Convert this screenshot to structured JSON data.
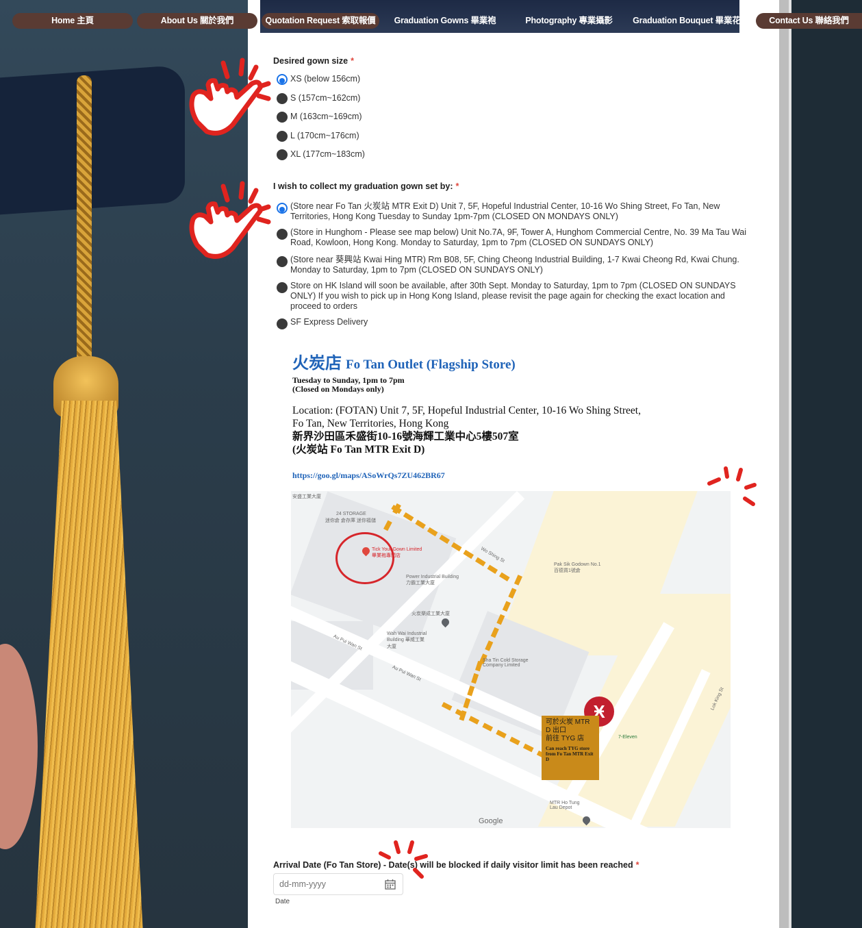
{
  "nav": {
    "items": [
      {
        "label": "Home 主頁"
      },
      {
        "label": "About Us 關於我們"
      },
      {
        "label": "Quotation Request 索取報價"
      },
      {
        "label": "Graduation Gowns 畢業袍"
      },
      {
        "label": "Photography 專業攝影"
      },
      {
        "label": "Graduation Bouquet 畢業花束"
      },
      {
        "label": "Contact Us 聯絡我們"
      }
    ]
  },
  "gown_size": {
    "label": "Desired gown size",
    "required_mark": "*",
    "options": [
      {
        "label": "XS (below 156cm)",
        "selected": true
      },
      {
        "label": "S (157cm~162cm)",
        "selected": false
      },
      {
        "label": "M (163cm~169cm)",
        "selected": false
      },
      {
        "label": "L (170cm~176cm)",
        "selected": false
      },
      {
        "label": "XL (177cm~183cm)",
        "selected": false
      }
    ]
  },
  "collection": {
    "label": "I wish to collect my graduation gown set by:",
    "required_mark": "*",
    "options": [
      {
        "label": "(Store near Fo Tan 火炭站 MTR Exit D) Unit 7, 5F, Hopeful Industrial Center, 10-16 Wo Shing Street, Fo Tan, New Territories, Hong Kong Tuesday to Sunday 1pm-7pm (CLOSED ON MONDAYS ONLY)",
        "selected": true
      },
      {
        "label": "(Store in Hunghom - Please see map below) Unit No.7A, 9F, Tower A, Hunghom Commercial Centre, No. 39 Ma Tau Wai Road, Kowloon, Hong Kong. Monday to Saturday, 1pm to 7pm (CLOSED ON SUNDAYS ONLY)",
        "selected": false
      },
      {
        "label": "(Store near 葵興站 Kwai Hing MTR) Rm B08, 5F, Ching Cheong Industrial Building, 1-7 Kwai Cheong Rd, Kwai Chung. Monday to Saturday, 1pm to 7pm (CLOSED ON SUNDAYS ONLY)",
        "selected": false
      },
      {
        "label": "Store on HK Island will soon be available, after 30th Sept. Monday to Saturday, 1pm to 7pm (CLOSED ON SUNDAYS ONLY)  If you wish to pick up in Hong Kong Island, please revisit the page again for checking the exact location and proceed to orders",
        "selected": false
      },
      {
        "label": "SF Express Delivery",
        "selected": false
      }
    ]
  },
  "store": {
    "title_zh": "火炭店",
    "title_en": "Fo Tan Outlet (Flagship Store)",
    "hours_1": "Tuesday to Sunday, 1pm to 7pm",
    "hours_2": "(Closed on Mondays only)",
    "location_1": "Location: (FOTAN) Unit 7, 5F, Hopeful Industrial Center, 10-16 Wo Shing Street,",
    "location_2": "Fo Tan, New Territories, Hong Kong",
    "location_zh": "新界沙田區禾盛街10-16號海輝工業中心5樓507室",
    "location_exit": "(火炭站 Fo Tan MTR Exit D)",
    "map_link": "https://goo.gl/maps/ASoWrQs7ZU462BR67"
  },
  "map": {
    "labels": {
      "top_left": "安盛工業大廈",
      "storage": "24 STORAGE",
      "storage_sub": "迷你倉 倉存庫 迷你福儲",
      "shop": "Tick Your Gown Limited 畢業袍專門店",
      "power": "Power Industrial Building 力霸工業大廈",
      "pak_shek": "Pak Sik Godown No.1 百德貨1號倉",
      "fotan_ind": "火炭樂成工業大廈",
      "wah_wai": "Wah Wai Industrial Building 華威工業大廈",
      "shatin_cold": "Sha Tin Cold Storage Company Limited",
      "au_pui_1": "Au Pui Wan St",
      "au_pui_2": "Au Pui Wan St",
      "wo_shing": "Wo Shing St",
      "lok_king": "Lok King St",
      "seven_eleven": "7-Eleven",
      "mtr_ho_tung": "MTR Ho Tung Lau Depot",
      "google": "Google"
    },
    "callout_1": "可於火炭 MTR",
    "callout_2": "D 出口",
    "callout_3": "前往 TYG 店",
    "callout_4": "Can reach TYG store from Fo Tan MTR Exit D",
    "mtr_symbol": "Ӿ"
  },
  "arrival": {
    "label": "Arrival Date (Fo Tan Store) - Date(s) will be blocked if daily visitor limit has been reached",
    "required_mark": "*",
    "placeholder": "dd-mm-yyyy",
    "caption": "Date"
  },
  "colors": {
    "accent": "#1a73e8",
    "required": "#e0483e",
    "nav_pill": "#5a3b33",
    "route": "#e9a11c",
    "store_title": "#1f63b8"
  }
}
